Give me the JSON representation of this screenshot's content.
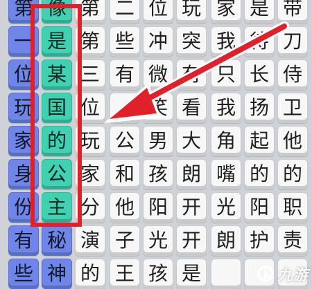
{
  "grid": {
    "rows": [
      [
        "第",
        "像",
        "第",
        "二",
        "位",
        "玩",
        "家",
        "是",
        "带"
      ],
      [
        "一",
        "是",
        "第",
        "些",
        "冲",
        "突",
        "我",
        "待",
        "刀"
      ],
      [
        "位",
        "某",
        "三",
        "有",
        "微",
        "有",
        "只",
        "长",
        "侍"
      ],
      [
        "玩",
        "国",
        "位",
        "",
        "笑",
        "看",
        "我",
        "扬",
        "卫"
      ],
      [
        "家",
        "的",
        "玩",
        "公",
        "男",
        "大",
        "角",
        "起",
        "他"
      ],
      [
        "身",
        "公",
        "家",
        "和",
        "孩",
        "朗",
        "嘴",
        "的",
        "的"
      ],
      [
        "份",
        "主",
        "分",
        "他",
        "阳",
        "开",
        "光",
        "阳",
        "职"
      ],
      [
        "有",
        "秘",
        "演",
        "子",
        "光",
        "开",
        "朗",
        "护",
        "责"
      ],
      [
        "些",
        "神",
        "的",
        "王",
        "孩",
        "是",
        "",
        "",
        ""
      ]
    ],
    "colors": {
      "blue": "#6f86e8",
      "green": "#3fd1b1",
      "white": "#f7f7f7",
      "highlight": "#e0212b"
    }
  },
  "watermark": {
    "text": "九游",
    "icon": "nine-game-logo-icon"
  }
}
